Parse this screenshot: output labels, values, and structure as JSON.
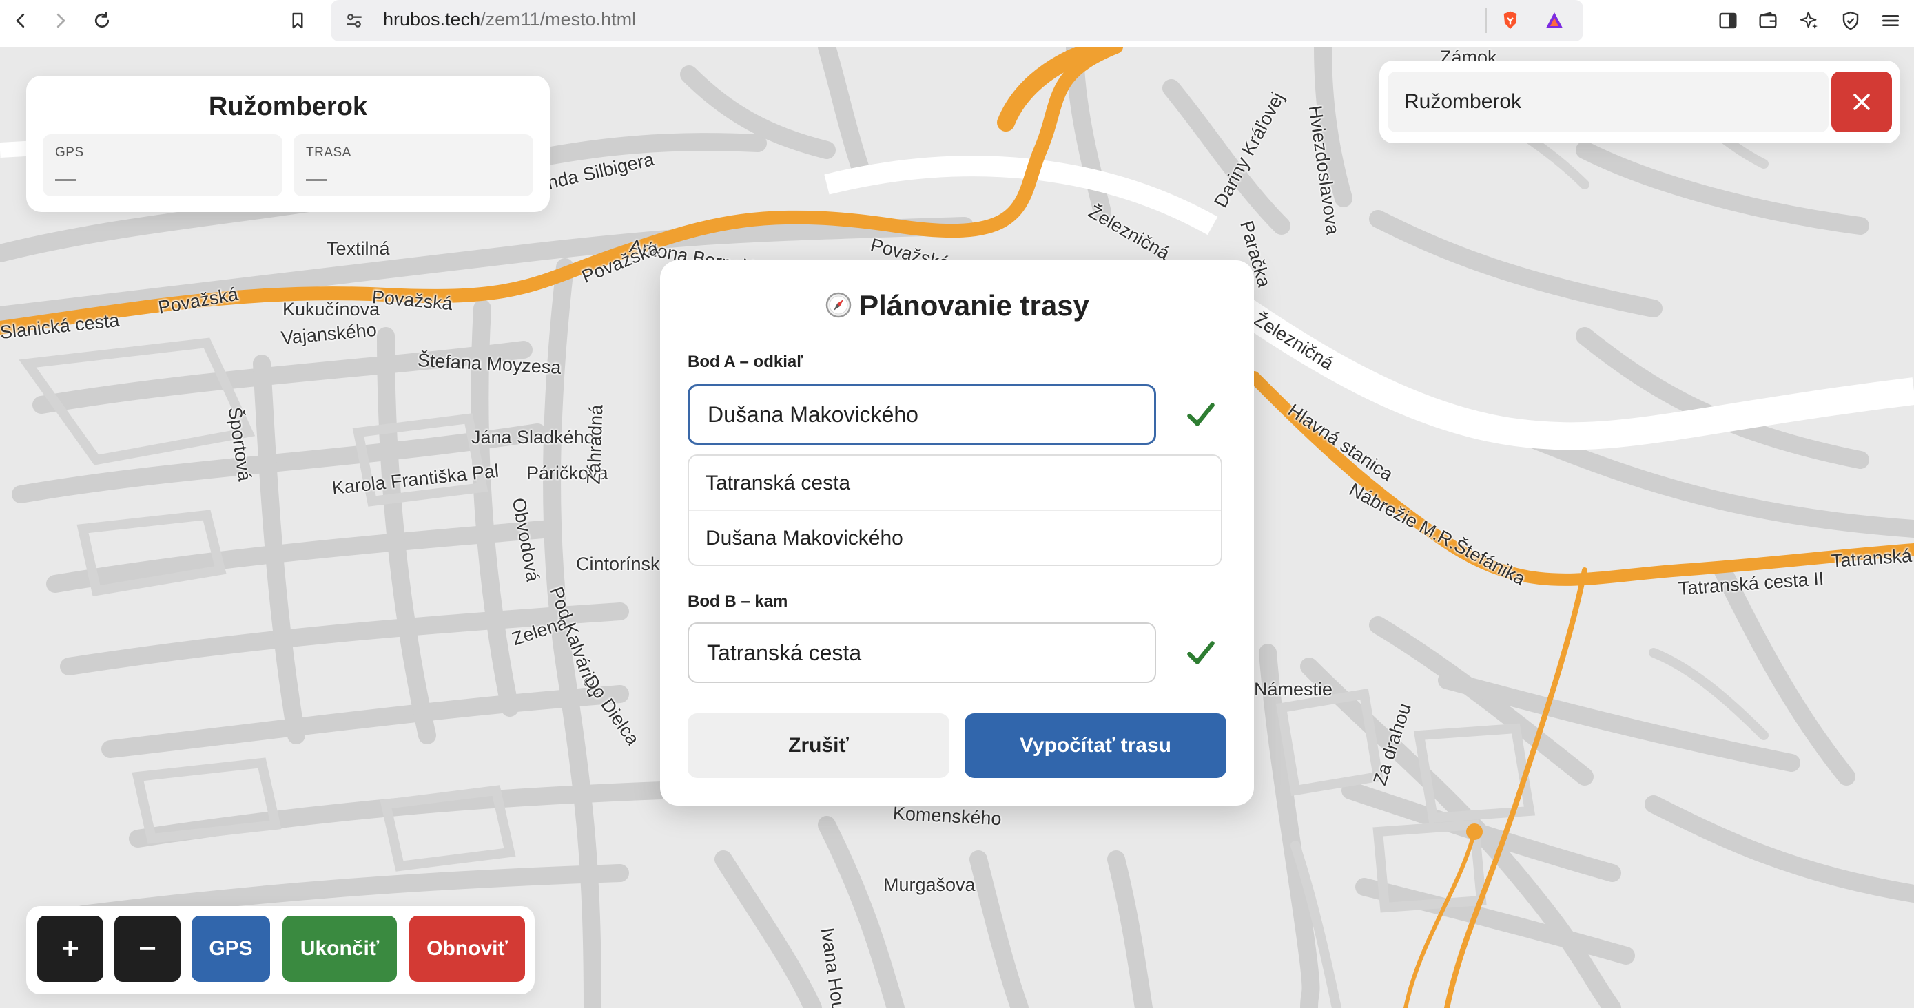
{
  "browser": {
    "url_host": "hrubos.tech",
    "url_path": "/zem11/mesto.html"
  },
  "city_card": {
    "title": "Ružomberok",
    "stats": [
      {
        "label": "GPS",
        "value": "—"
      },
      {
        "label": "TRASA",
        "value": "—"
      }
    ]
  },
  "search": {
    "value": "Ružomberok"
  },
  "map": {
    "street_labels": [
      "Žigmunda Silbigera",
      "Textilná",
      "Antona Bernoláku",
      "Považská",
      "Považská",
      "Považská",
      "Považská",
      "Kukučínova",
      "Vajanského",
      "Štefana Moyzesa",
      "Športová",
      "Jána Sladkého",
      "Karola Františka Pal",
      "Páričkova",
      "Obvodová",
      "Záhradná",
      "Cintorínska",
      "Zelená",
      "Pod Kalváriou",
      "Do Dielca",
      "Železničná",
      "Železničná",
      "Dariny Kráľovej",
      "Paračka",
      "Hviezdoslavova",
      "Hlavná stanica",
      "Nábrežie M.R.Štefánika",
      "Tatranská cesta II",
      "Tatranská",
      "Za drahou",
      "Komenského",
      "Murgašova",
      "Ivana Hou",
      "Slanická cesta",
      "Námestie",
      "Zámok"
    ]
  },
  "dialog": {
    "title": "Plánovanie trasy",
    "point_a_label": "Bod A – odkiaľ",
    "point_a_value": "Dušana Makovického",
    "suggestions": [
      "Tatranská cesta",
      "Dušana Makovického"
    ],
    "point_b_label": "Bod B – kam",
    "point_b_value": "Tatranská cesta",
    "cancel_label": "Zrušiť",
    "compute_label": "Vypočítať trasu"
  },
  "toolbar": {
    "zoom_in": "+",
    "zoom_out": "−",
    "gps": "GPS",
    "end": "Ukončiť",
    "refresh": "Obnoviť"
  },
  "colors": {
    "accent_blue": "#3166ac",
    "danger_red": "#d33a34",
    "success_green": "#3a8a40",
    "route_orange": "#f0a030",
    "check_green": "#2e7d32"
  },
  "icons": [
    "back-icon",
    "forward-icon",
    "reload-icon",
    "bookmark-icon",
    "site-settings-icon",
    "brave-shield-icon",
    "rewards-icon",
    "sidebar-icon",
    "wallet-icon",
    "leo-icon",
    "vpn-icon",
    "menu-icon",
    "close-icon",
    "check-icon",
    "compass-icon"
  ]
}
